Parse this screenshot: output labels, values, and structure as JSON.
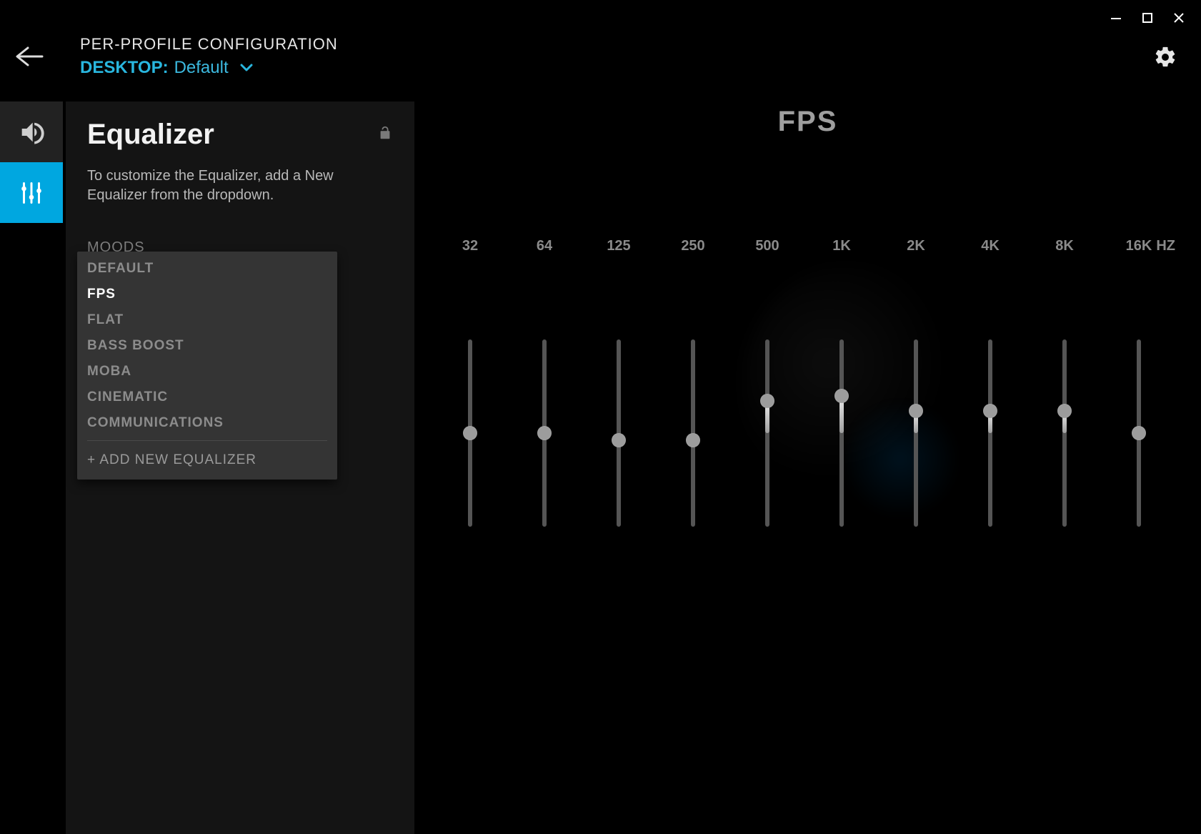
{
  "window": {
    "min": "minimize",
    "max": "maximize",
    "close": "close"
  },
  "header": {
    "config_label": "PER-PROFILE CONFIGURATION",
    "desktop_label": "DESKTOP:",
    "profile_name": "Default"
  },
  "rail": {
    "sound": "sound",
    "eq": "equalizer"
  },
  "panel": {
    "title": "Equalizer",
    "description": "To customize the Equalizer, add a New Equalizer from the dropdown.",
    "moods_label": "MOODS"
  },
  "dropdown": {
    "items": [
      "DEFAULT",
      "FPS",
      "FLAT",
      "BASS BOOST",
      "MOBA",
      "CINEMATIC",
      "COMMUNICATIONS"
    ],
    "selected_index": 1,
    "add_label": "+ ADD NEW EQUALIZER"
  },
  "equalizer": {
    "preset_title": "FPS",
    "hz_label": "HZ",
    "bands": [
      "32",
      "64",
      "125",
      "250",
      "500",
      "1K",
      "2K",
      "4K",
      "8K",
      "16K"
    ],
    "values": [
      50,
      50,
      46,
      46,
      67,
      70,
      62,
      62,
      62,
      50
    ],
    "track_height": 262,
    "center": 50
  },
  "chart_data": {
    "type": "bar",
    "title": "FPS",
    "xlabel": "HZ",
    "ylabel": "",
    "categories": [
      "32",
      "64",
      "125",
      "250",
      "500",
      "1K",
      "2K",
      "4K",
      "8K",
      "16K"
    ],
    "values": [
      50,
      50,
      46,
      46,
      67,
      70,
      62,
      62,
      62,
      50
    ],
    "ylim": [
      0,
      100
    ]
  }
}
